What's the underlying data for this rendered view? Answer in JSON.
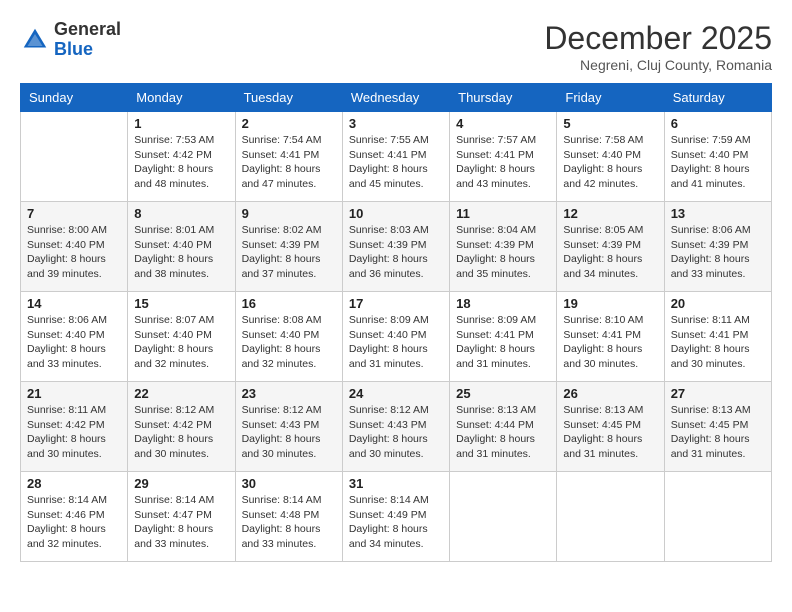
{
  "header": {
    "logo": {
      "line1": "General",
      "line2": "Blue"
    },
    "title": "December 2025",
    "subtitle": "Negreni, Cluj County, Romania"
  },
  "weekdays": [
    "Sunday",
    "Monday",
    "Tuesday",
    "Wednesday",
    "Thursday",
    "Friday",
    "Saturday"
  ],
  "weeks": [
    [
      {
        "day": "",
        "sunrise": "",
        "sunset": "",
        "daylight": ""
      },
      {
        "day": "1",
        "sunrise": "Sunrise: 7:53 AM",
        "sunset": "Sunset: 4:42 PM",
        "daylight": "Daylight: 8 hours and 48 minutes."
      },
      {
        "day": "2",
        "sunrise": "Sunrise: 7:54 AM",
        "sunset": "Sunset: 4:41 PM",
        "daylight": "Daylight: 8 hours and 47 minutes."
      },
      {
        "day": "3",
        "sunrise": "Sunrise: 7:55 AM",
        "sunset": "Sunset: 4:41 PM",
        "daylight": "Daylight: 8 hours and 45 minutes."
      },
      {
        "day": "4",
        "sunrise": "Sunrise: 7:57 AM",
        "sunset": "Sunset: 4:41 PM",
        "daylight": "Daylight: 8 hours and 43 minutes."
      },
      {
        "day": "5",
        "sunrise": "Sunrise: 7:58 AM",
        "sunset": "Sunset: 4:40 PM",
        "daylight": "Daylight: 8 hours and 42 minutes."
      },
      {
        "day": "6",
        "sunrise": "Sunrise: 7:59 AM",
        "sunset": "Sunset: 4:40 PM",
        "daylight": "Daylight: 8 hours and 41 minutes."
      }
    ],
    [
      {
        "day": "7",
        "sunrise": "Sunrise: 8:00 AM",
        "sunset": "Sunset: 4:40 PM",
        "daylight": "Daylight: 8 hours and 39 minutes."
      },
      {
        "day": "8",
        "sunrise": "Sunrise: 8:01 AM",
        "sunset": "Sunset: 4:40 PM",
        "daylight": "Daylight: 8 hours and 38 minutes."
      },
      {
        "day": "9",
        "sunrise": "Sunrise: 8:02 AM",
        "sunset": "Sunset: 4:39 PM",
        "daylight": "Daylight: 8 hours and 37 minutes."
      },
      {
        "day": "10",
        "sunrise": "Sunrise: 8:03 AM",
        "sunset": "Sunset: 4:39 PM",
        "daylight": "Daylight: 8 hours and 36 minutes."
      },
      {
        "day": "11",
        "sunrise": "Sunrise: 8:04 AM",
        "sunset": "Sunset: 4:39 PM",
        "daylight": "Daylight: 8 hours and 35 minutes."
      },
      {
        "day": "12",
        "sunrise": "Sunrise: 8:05 AM",
        "sunset": "Sunset: 4:39 PM",
        "daylight": "Daylight: 8 hours and 34 minutes."
      },
      {
        "day": "13",
        "sunrise": "Sunrise: 8:06 AM",
        "sunset": "Sunset: 4:39 PM",
        "daylight": "Daylight: 8 hours and 33 minutes."
      }
    ],
    [
      {
        "day": "14",
        "sunrise": "Sunrise: 8:06 AM",
        "sunset": "Sunset: 4:40 PM",
        "daylight": "Daylight: 8 hours and 33 minutes."
      },
      {
        "day": "15",
        "sunrise": "Sunrise: 8:07 AM",
        "sunset": "Sunset: 4:40 PM",
        "daylight": "Daylight: 8 hours and 32 minutes."
      },
      {
        "day": "16",
        "sunrise": "Sunrise: 8:08 AM",
        "sunset": "Sunset: 4:40 PM",
        "daylight": "Daylight: 8 hours and 32 minutes."
      },
      {
        "day": "17",
        "sunrise": "Sunrise: 8:09 AM",
        "sunset": "Sunset: 4:40 PM",
        "daylight": "Daylight: 8 hours and 31 minutes."
      },
      {
        "day": "18",
        "sunrise": "Sunrise: 8:09 AM",
        "sunset": "Sunset: 4:41 PM",
        "daylight": "Daylight: 8 hours and 31 minutes."
      },
      {
        "day": "19",
        "sunrise": "Sunrise: 8:10 AM",
        "sunset": "Sunset: 4:41 PM",
        "daylight": "Daylight: 8 hours and 30 minutes."
      },
      {
        "day": "20",
        "sunrise": "Sunrise: 8:11 AM",
        "sunset": "Sunset: 4:41 PM",
        "daylight": "Daylight: 8 hours and 30 minutes."
      }
    ],
    [
      {
        "day": "21",
        "sunrise": "Sunrise: 8:11 AM",
        "sunset": "Sunset: 4:42 PM",
        "daylight": "Daylight: 8 hours and 30 minutes."
      },
      {
        "day": "22",
        "sunrise": "Sunrise: 8:12 AM",
        "sunset": "Sunset: 4:42 PM",
        "daylight": "Daylight: 8 hours and 30 minutes."
      },
      {
        "day": "23",
        "sunrise": "Sunrise: 8:12 AM",
        "sunset": "Sunset: 4:43 PM",
        "daylight": "Daylight: 8 hours and 30 minutes."
      },
      {
        "day": "24",
        "sunrise": "Sunrise: 8:12 AM",
        "sunset": "Sunset: 4:43 PM",
        "daylight": "Daylight: 8 hours and 30 minutes."
      },
      {
        "day": "25",
        "sunrise": "Sunrise: 8:13 AM",
        "sunset": "Sunset: 4:44 PM",
        "daylight": "Daylight: 8 hours and 31 minutes."
      },
      {
        "day": "26",
        "sunrise": "Sunrise: 8:13 AM",
        "sunset": "Sunset: 4:45 PM",
        "daylight": "Daylight: 8 hours and 31 minutes."
      },
      {
        "day": "27",
        "sunrise": "Sunrise: 8:13 AM",
        "sunset": "Sunset: 4:45 PM",
        "daylight": "Daylight: 8 hours and 31 minutes."
      }
    ],
    [
      {
        "day": "28",
        "sunrise": "Sunrise: 8:14 AM",
        "sunset": "Sunset: 4:46 PM",
        "daylight": "Daylight: 8 hours and 32 minutes."
      },
      {
        "day": "29",
        "sunrise": "Sunrise: 8:14 AM",
        "sunset": "Sunset: 4:47 PM",
        "daylight": "Daylight: 8 hours and 33 minutes."
      },
      {
        "day": "30",
        "sunrise": "Sunrise: 8:14 AM",
        "sunset": "Sunset: 4:48 PM",
        "daylight": "Daylight: 8 hours and 33 minutes."
      },
      {
        "day": "31",
        "sunrise": "Sunrise: 8:14 AM",
        "sunset": "Sunset: 4:49 PM",
        "daylight": "Daylight: 8 hours and 34 minutes."
      },
      {
        "day": "",
        "sunrise": "",
        "sunset": "",
        "daylight": ""
      },
      {
        "day": "",
        "sunrise": "",
        "sunset": "",
        "daylight": ""
      },
      {
        "day": "",
        "sunrise": "",
        "sunset": "",
        "daylight": ""
      }
    ]
  ]
}
